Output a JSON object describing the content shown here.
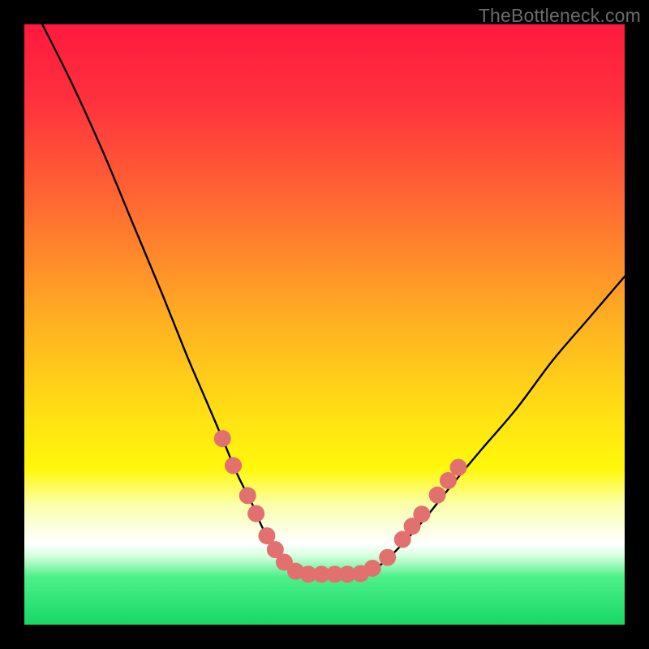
{
  "watermark": {
    "text": "TheBottleneck.com"
  },
  "colors": {
    "bg": "#000000",
    "curve_stroke": "#000000",
    "dot_fill": "#e2706e",
    "dot_stroke": "#000000",
    "gradient_stops": [
      {
        "offset": 0.0,
        "color": "#ff1a3f"
      },
      {
        "offset": 0.12,
        "color": "#ff2f3e"
      },
      {
        "offset": 0.3,
        "color": "#ff6a32"
      },
      {
        "offset": 0.5,
        "color": "#ffb222"
      },
      {
        "offset": 0.66,
        "color": "#ffe313"
      },
      {
        "offset": 0.74,
        "color": "#fff80a"
      },
      {
        "offset": 0.8,
        "color": "#fbffaa"
      },
      {
        "offset": 0.84,
        "color": "#fcffe0"
      },
      {
        "offset": 0.865,
        "color": "#ffffff"
      },
      {
        "offset": 0.885,
        "color": "#d8ffe0"
      },
      {
        "offset": 0.92,
        "color": "#4ef089"
      },
      {
        "offset": 1.0,
        "color": "#17d867"
      }
    ]
  },
  "chart_data": {
    "type": "line",
    "title": "",
    "xlabel": "",
    "ylabel": "",
    "xlim": [
      0,
      100
    ],
    "ylim": [
      0,
      100
    ],
    "grid": false,
    "legend": false,
    "series": [
      {
        "name": "bottleneck-curve",
        "x": [
          3,
          8,
          13,
          18,
          23,
          27,
          30,
          33,
          35.5,
          38,
          40,
          43,
          45.5,
          48,
          51,
          54,
          57,
          60,
          63.5,
          67,
          71,
          76,
          82,
          88,
          94,
          100
        ],
        "y": [
          100,
          90,
          79,
          67,
          55,
          45,
          38,
          31,
          25,
          20,
          15.5,
          11,
          8.6,
          8.4,
          8.4,
          8.4,
          8.6,
          10.5,
          14,
          18,
          23,
          29,
          36,
          44,
          51,
          58
        ]
      }
    ],
    "scatter_points": {
      "name": "highlight-dots",
      "points": [
        {
          "x": 33.0,
          "y": 31.0
        },
        {
          "x": 34.8,
          "y": 26.5
        },
        {
          "x": 37.2,
          "y": 21.5
        },
        {
          "x": 38.6,
          "y": 18.5
        },
        {
          "x": 40.4,
          "y": 14.8
        },
        {
          "x": 41.8,
          "y": 12.5
        },
        {
          "x": 43.3,
          "y": 10.4
        },
        {
          "x": 45.2,
          "y": 8.9
        },
        {
          "x": 47.3,
          "y": 8.4
        },
        {
          "x": 49.5,
          "y": 8.4
        },
        {
          "x": 51.7,
          "y": 8.4
        },
        {
          "x": 53.8,
          "y": 8.4
        },
        {
          "x": 56.0,
          "y": 8.5
        },
        {
          "x": 58.0,
          "y": 9.4
        },
        {
          "x": 60.5,
          "y": 11.2
        },
        {
          "x": 63.0,
          "y": 14.2
        },
        {
          "x": 64.6,
          "y": 16.4
        },
        {
          "x": 66.2,
          "y": 18.4
        },
        {
          "x": 68.8,
          "y": 21.6
        },
        {
          "x": 70.6,
          "y": 24.0
        },
        {
          "x": 72.3,
          "y": 26.2
        }
      ]
    }
  }
}
